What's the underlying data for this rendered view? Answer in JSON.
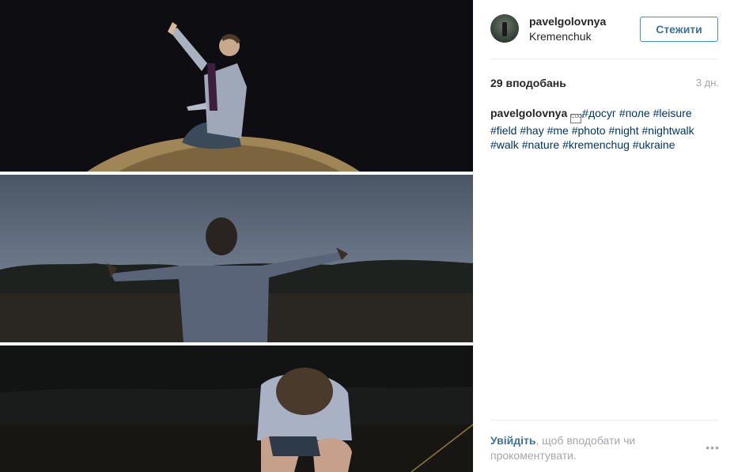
{
  "post": {
    "username": "pavelgolovnya",
    "location": "Kremenchuk",
    "follow_label": "Стежити",
    "likes": "29 вподобань",
    "age": "3 дн.",
    "caption_author": "pavelgolovnya",
    "caption_emoji": "🆒",
    "hashtags": [
      "#досуг",
      "#поле",
      "#leisure",
      "#field",
      "#hay",
      "#me",
      "#photo",
      "#night",
      "#nightwalk",
      "#walk",
      "#nature",
      "#kremenchug",
      "#ukraine"
    ],
    "login_link": "Увійдіть",
    "login_text": ", щоб вподобати чи прокоментувати.",
    "more_icon": "•••"
  }
}
